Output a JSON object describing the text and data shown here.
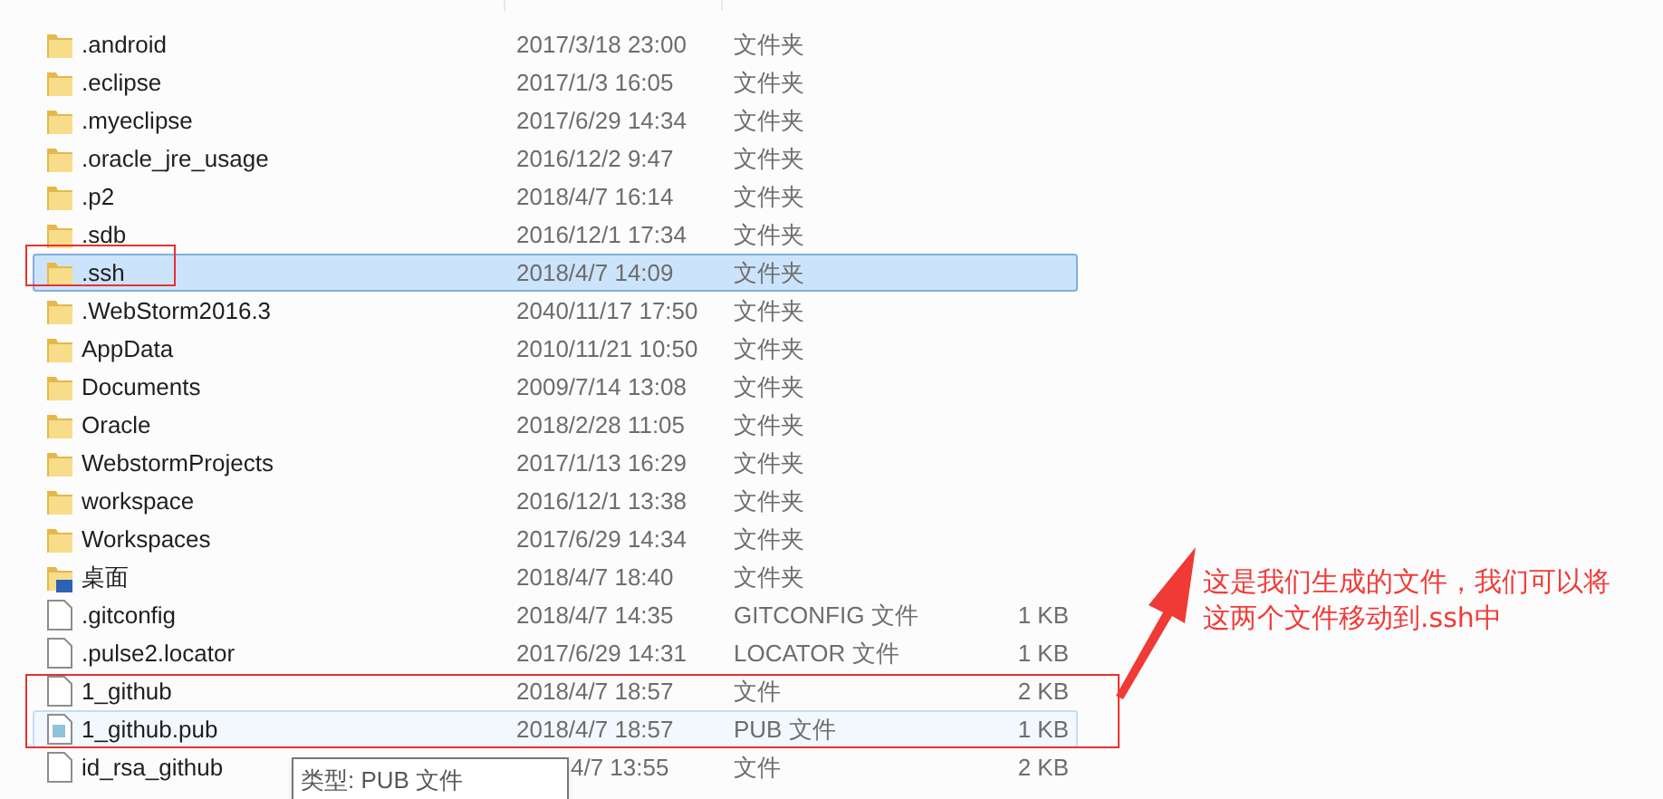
{
  "files": [
    {
      "name": ".android",
      "date": "2017/3/18 23:00",
      "type": "文件夹",
      "kind": "folder",
      "selected": false,
      "hovered": false
    },
    {
      "name": ".eclipse",
      "date": "2017/1/3 16:05",
      "type": "文件夹",
      "kind": "folder",
      "selected": false,
      "hovered": false
    },
    {
      "name": ".myeclipse",
      "date": "2017/6/29 14:34",
      "type": "文件夹",
      "kind": "folder",
      "selected": false,
      "hovered": false
    },
    {
      "name": ".oracle_jre_usage",
      "date": "2016/12/2 9:47",
      "type": "文件夹",
      "kind": "folder",
      "selected": false,
      "hovered": false
    },
    {
      "name": ".p2",
      "date": "2018/4/7 16:14",
      "type": "文件夹",
      "kind": "folder",
      "selected": false,
      "hovered": false
    },
    {
      "name": ".sdb",
      "date": "2016/12/1 17:34",
      "type": "文件夹",
      "kind": "folder",
      "selected": false,
      "hovered": false
    },
    {
      "name": ".ssh",
      "date": "2018/4/7 14:09",
      "type": "文件夹",
      "kind": "folder",
      "selected": true,
      "hovered": false
    },
    {
      "name": ".WebStorm2016.3",
      "date": "2040/11/17 17:50",
      "type": "文件夹",
      "kind": "folder",
      "selected": false,
      "hovered": false
    },
    {
      "name": "AppData",
      "date": "2010/11/21 10:50",
      "type": "文件夹",
      "kind": "folder",
      "selected": false,
      "hovered": false
    },
    {
      "name": "Documents",
      "date": "2009/7/14 13:08",
      "type": "文件夹",
      "kind": "folder",
      "selected": false,
      "hovered": false
    },
    {
      "name": "Oracle",
      "date": "2018/2/28 11:05",
      "type": "文件夹",
      "kind": "folder",
      "selected": false,
      "hovered": false
    },
    {
      "name": "WebstormProjects",
      "date": "2017/1/13 16:29",
      "type": "文件夹",
      "kind": "folder",
      "selected": false,
      "hovered": false
    },
    {
      "name": "workspace",
      "date": "2016/12/1 13:38",
      "type": "文件夹",
      "kind": "folder",
      "selected": false,
      "hovered": false
    },
    {
      "name": "Workspaces",
      "date": "2017/6/29 14:34",
      "type": "文件夹",
      "kind": "folder",
      "selected": false,
      "hovered": false
    },
    {
      "name": "桌面",
      "date": "2018/4/7 18:40",
      "type": "文件夹",
      "kind": "desktop",
      "selected": false,
      "hovered": false
    },
    {
      "name": ".gitconfig",
      "date": "2018/4/7 14:35",
      "type": "GITCONFIG 文件",
      "size": "1 KB",
      "kind": "file",
      "selected": false,
      "hovered": false
    },
    {
      "name": ".pulse2.locator",
      "date": "2017/6/29 14:31",
      "type": "LOCATOR 文件",
      "size": "1 KB",
      "kind": "file",
      "selected": false,
      "hovered": false
    },
    {
      "name": "1_github",
      "date": "2018/4/7 18:57",
      "type": "文件",
      "size": "2 KB",
      "kind": "file",
      "selected": false,
      "hovered": false
    },
    {
      "name": "1_github.pub",
      "date": "2018/4/7 18:57",
      "type": "PUB 文件",
      "size": "1 KB",
      "kind": "pub",
      "selected": false,
      "hovered": true
    },
    {
      "name": "id_rsa_github",
      "date": "4/7 13:55",
      "type": "文件",
      "size": "2 KB",
      "kind": "file",
      "selected": false,
      "hovered": false
    }
  ],
  "tooltip": "类型: PUB 文件",
  "annotation": "这是我们生成的文件，我们可以将这两个文件移动到.ssh中"
}
